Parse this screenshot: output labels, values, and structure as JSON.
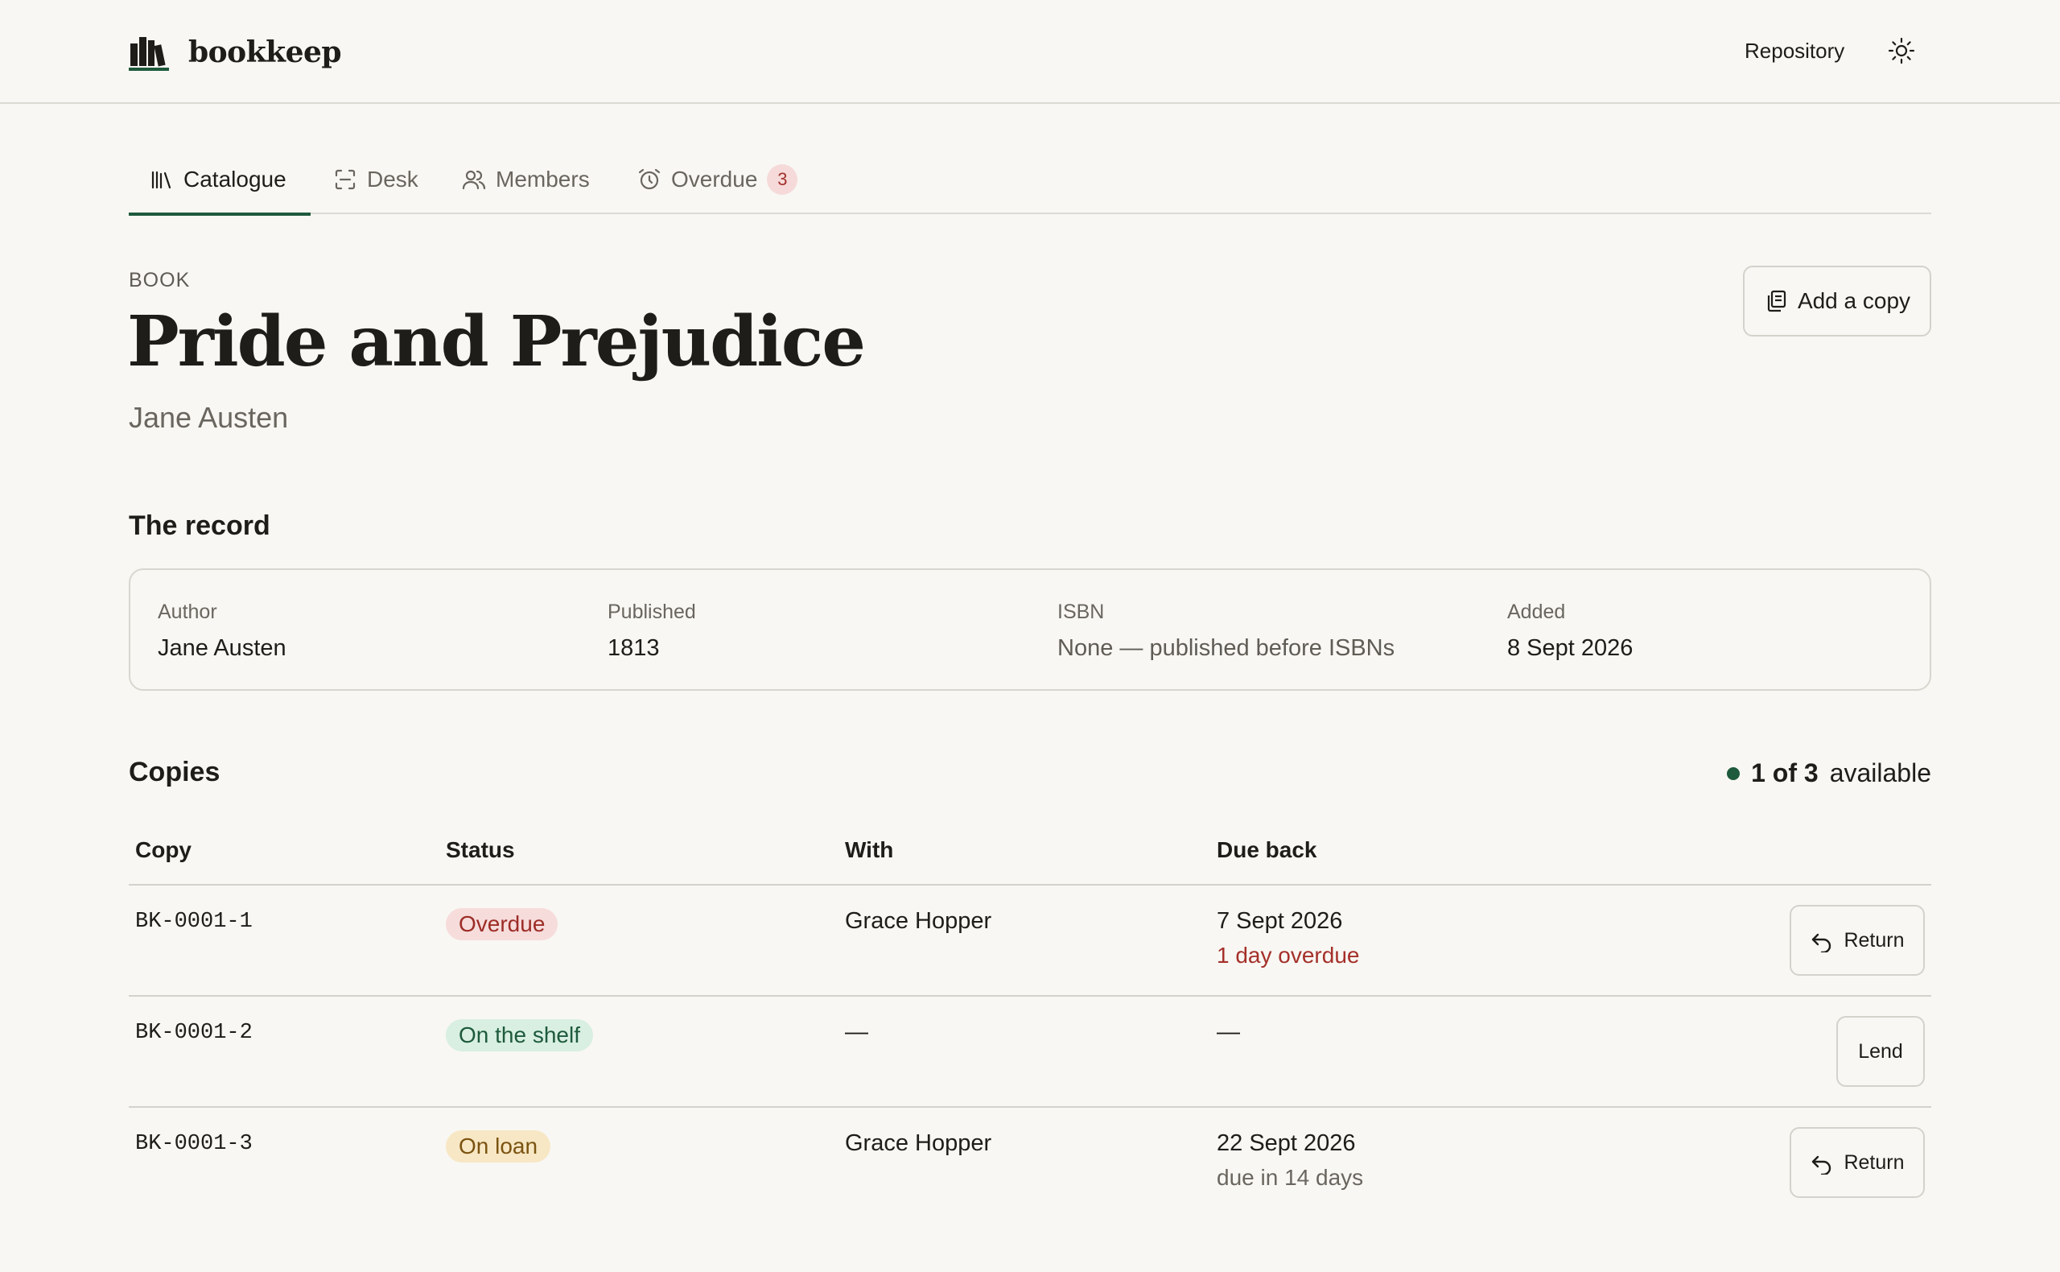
{
  "brand": {
    "name": "bookkeep"
  },
  "header": {
    "repository_label": "Repository"
  },
  "tabs": [
    {
      "label": "Catalogue",
      "active": true
    },
    {
      "label": "Desk"
    },
    {
      "label": "Members"
    },
    {
      "label": "Overdue",
      "badge": "3"
    }
  ],
  "book": {
    "kicker": "BOOK",
    "title": "Pride and Prejudice",
    "author": "Jane Austen",
    "add_copy_label": "Add a copy"
  },
  "record": {
    "heading": "The record",
    "fields": [
      {
        "label": "Author",
        "value": "Jane Austen"
      },
      {
        "label": "Published",
        "value": "1813"
      },
      {
        "label": "ISBN",
        "value": "None — published before ISBNs"
      },
      {
        "label": "Added",
        "value": "8 Sept 2026"
      }
    ]
  },
  "copies": {
    "heading": "Copies",
    "availability": {
      "count": "1 of 3",
      "label": "available"
    },
    "columns": [
      "Copy",
      "Status",
      "With",
      "Due back"
    ],
    "rows": [
      {
        "copy": "BK-0001-1",
        "status": "Overdue",
        "with": "Grace Hopper",
        "due": "7 Sept 2026",
        "due_note": "1 day overdue",
        "action": "Return"
      },
      {
        "copy": "BK-0001-2",
        "status": "On the shelf",
        "with": "—",
        "due": "—",
        "due_note": "",
        "action": "Lend"
      },
      {
        "copy": "BK-0001-3",
        "status": "On loan",
        "with": "Grace Hopper",
        "due": "22 Sept 2026",
        "due_note": "due in 14 days",
        "action": "Return"
      }
    ]
  },
  "colors": {
    "accent": "#1e5a3c",
    "overdue": "#a5302a",
    "background": "#f8f7f3"
  },
  "icons": [
    "bookshelf-logo-icon",
    "sun-icon",
    "library-icon",
    "scan-icon",
    "users-icon",
    "alarm-clock-icon",
    "copy-icon",
    "undo-icon"
  ]
}
